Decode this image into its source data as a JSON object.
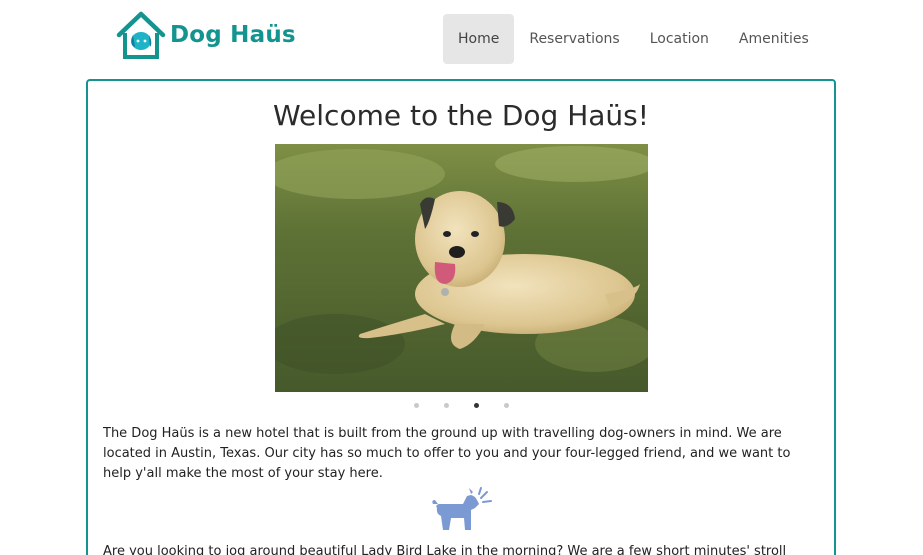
{
  "brand": {
    "name": "Dog Haüs",
    "color": "#13948f",
    "icon": "house-dog-logo-icon"
  },
  "nav": {
    "items": [
      {
        "label": "Home",
        "active": true
      },
      {
        "label": "Reservations",
        "active": false
      },
      {
        "label": "Location",
        "active": false
      },
      {
        "label": "Amenities",
        "active": false
      }
    ]
  },
  "main": {
    "title": "Welcome to the Dog Haüs!",
    "carousel": {
      "slide_count": 4,
      "active_index": 2,
      "image": "dog-lying-on-grass-photo"
    },
    "paragraphs": [
      "The Dog Haüs is a new hotel that is built from the ground up with travelling dog-owners in mind. We are located in Austin, Texas. Our city has so much to offer to you and your four-legged friend, and we want to help y'all make the most of your stay here.",
      "Are you looking to jog around beautiful Lady Bird Lake in the morning? We are a few short minutes' stroll from"
    ],
    "divider_icon": "barking-dog-icon"
  },
  "colors": {
    "accent": "#13948f",
    "nav_active_bg": "#e6e6e6",
    "icon_blue": "#7b9ad3"
  }
}
